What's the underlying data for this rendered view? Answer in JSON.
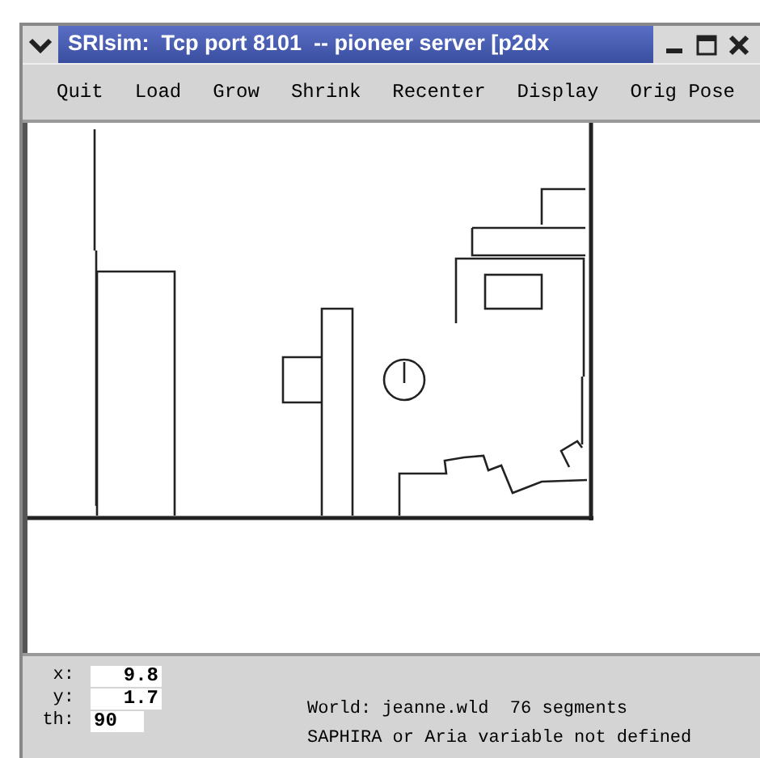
{
  "window": {
    "title": "SRIsim:  Tcp port 8101  -- pioneer server [p2dx"
  },
  "menu": [
    "Quit",
    "Load",
    "Grow",
    "Shrink",
    "Recenter",
    "Display",
    "Orig Pose"
  ],
  "pose": [
    {
      "label": "x:",
      "value": "9.8"
    },
    {
      "label": "y:",
      "value": "1.7"
    },
    {
      "label": "th:",
      "value": "90"
    }
  ],
  "status": [
    "World: jeanne.wld  76 segments",
    "SAPHIRA or Aria variable not defined"
  ]
}
